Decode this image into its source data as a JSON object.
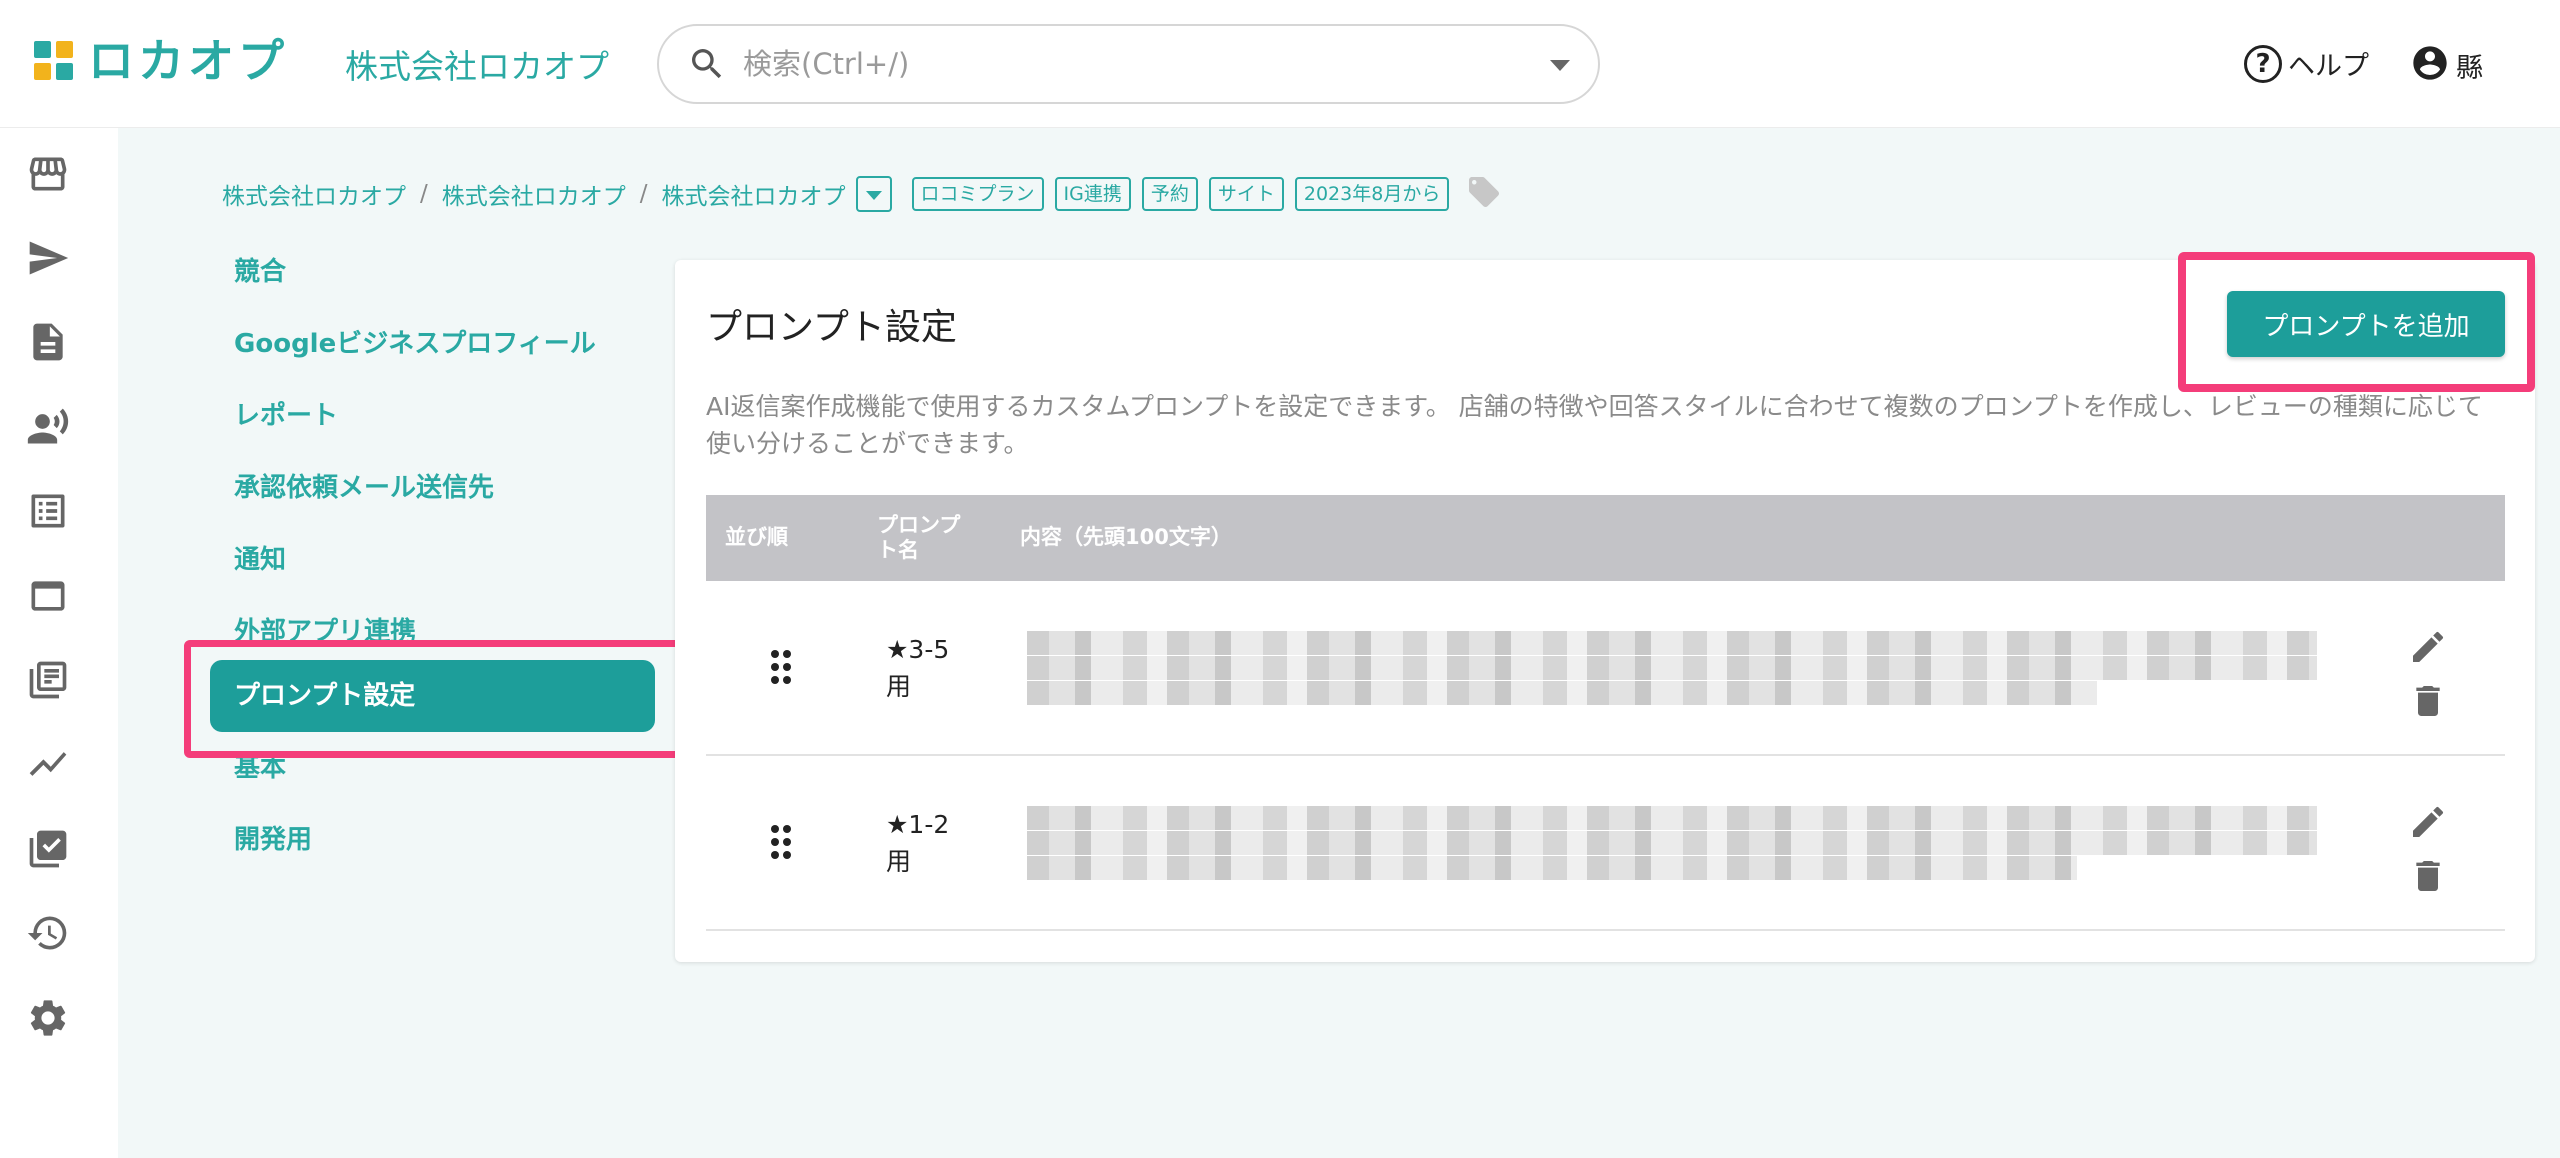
{
  "header": {
    "logo_text": "ロカオプ",
    "company": "株式会社ロカオプ",
    "search_placeholder": "検索(Ctrl+/)",
    "help_label": "ヘルプ",
    "user_label": "縣"
  },
  "rail": {
    "icons": [
      "store-icon",
      "send-icon",
      "document-icon",
      "voice-person-icon",
      "list-icon",
      "window-icon",
      "library-icon",
      "trend-line-icon",
      "checklist-icon",
      "history-icon",
      "gear-icon"
    ]
  },
  "breadcrumb": {
    "items": [
      "株式会社ロカオプ",
      "株式会社ロカオプ",
      "株式会社ロカオプ"
    ],
    "separator": "/",
    "tags": [
      "ロコミプラン",
      "IG連携",
      "予約",
      "サイト",
      "2023年8月から"
    ]
  },
  "settings_nav": {
    "items": [
      "競合",
      "Googleビジネスプロフィール",
      "レポート",
      "承認依頼メール送信先",
      "通知",
      "外部アプリ連携",
      "プロンプト設定",
      "基本",
      "開発用"
    ],
    "active_index": 6
  },
  "card": {
    "title": "プロンプト設定",
    "add_button": "プロンプトを追加",
    "description": "AI返信案作成機能で使用するカスタムプロンプトを設定できます。 店舗の特徴や回答スタイルに合わせて複数のプロンプトを作成し、レビューの種類に応じて使い分けることができます。",
    "columns": [
      "並び順",
      "プロンプト名",
      "内容（先頭100文字）"
    ],
    "rows": [
      {
        "name": "★3-5用"
      },
      {
        "name": "★1-2用"
      }
    ]
  },
  "colors": {
    "accent": "#2aa9a3",
    "highlight": "#f43d7a",
    "table_header": "#c3c3c7"
  }
}
